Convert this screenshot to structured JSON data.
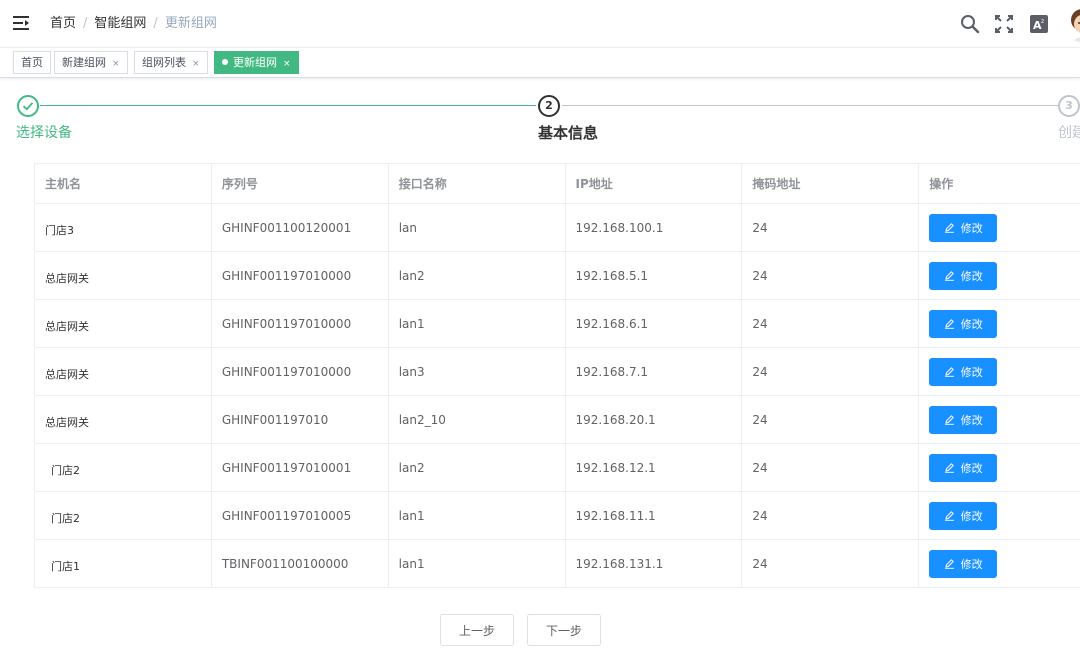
{
  "breadcrumb": {
    "home": "首页",
    "parent": "智能组网",
    "current": "更新组网"
  },
  "tags": [
    {
      "label": "首页"
    },
    {
      "label": "新建组网",
      "close": "×"
    },
    {
      "label": "组网列表",
      "close": "×"
    },
    {
      "label": "更新组网",
      "close": "×",
      "active": true
    }
  ],
  "steps": [
    {
      "title": "选择设备",
      "status": "finished"
    },
    {
      "number": "2",
      "title": "基本信息",
      "status": "current"
    },
    {
      "number": "3",
      "title": "创建",
      "status": "pending"
    }
  ],
  "table": {
    "columns": [
      "主机名",
      "序列号",
      "接口名称",
      "IP地址",
      "掩码地址",
      "操作"
    ],
    "action_label": "修改",
    "rows": [
      {
        "host": "门店3",
        "serial": "GHINF001100120001",
        "iface": "lan",
        "ip": "192.168.100.1",
        "mask": "24"
      },
      {
        "host": "总店网关",
        "serial": "GHINF001197010000",
        "iface": "lan2",
        "ip": "192.168.5.1",
        "mask": "24"
      },
      {
        "host": "总店网关",
        "serial": "GHINF001197010000",
        "iface": "lan1",
        "ip": "192.168.6.1",
        "mask": "24"
      },
      {
        "host": "总店网关",
        "serial": "GHINF001197010000",
        "iface": "lan3",
        "ip": "192.168.7.1",
        "mask": "24"
      },
      {
        "host": "总店网关",
        "serial": "GHINF001197010",
        "iface": "lan2_10",
        "ip": "192.168.20.1",
        "mask": "24"
      },
      {
        "host": "门店2",
        "serial": "GHINF001197010001",
        "iface": "lan2",
        "ip": "192.168.12.1",
        "mask": "24"
      },
      {
        "host": "门店2",
        "serial": "GHINF001197010005",
        "iface": "lan1",
        "ip": "192.168.11.1",
        "mask": "24"
      },
      {
        "host": "门店1",
        "serial": "TBINF001100100000",
        "iface": "lan1",
        "ip": "192.168.131.1",
        "mask": "24"
      }
    ]
  },
  "buttons": {
    "prev": "上一步",
    "next": "下一步"
  },
  "colors": {
    "success": "#42b983",
    "primary": "#1890ff",
    "active_tag": "#42b983"
  },
  "icons": {
    "menu": "hamburger-icon",
    "search": "search-icon",
    "fullscreen": "fullscreen-icon",
    "font_size": "font-size-icon",
    "edit": "edit-icon"
  }
}
